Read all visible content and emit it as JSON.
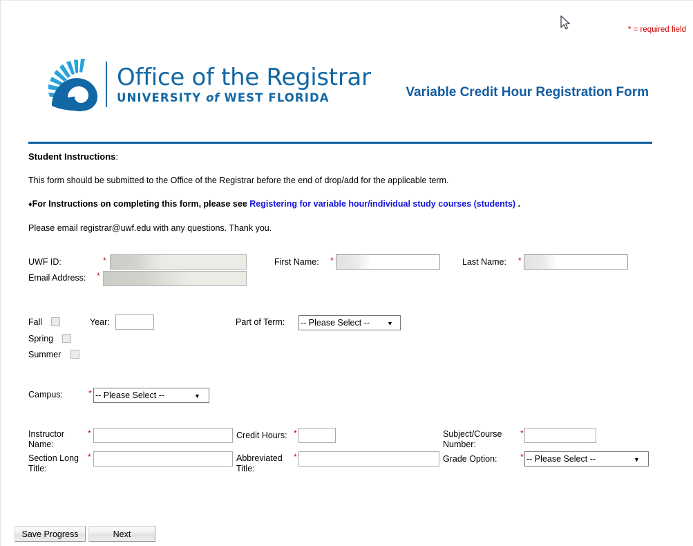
{
  "page": {
    "required_note": "* = required field",
    "form_title": "Variable Credit Hour Registration Form"
  },
  "logo": {
    "line1": "Office of the Registrar",
    "line2_pre": "UNIVERSITY ",
    "line2_italic": "of",
    "line2_post": " WEST FLORIDA"
  },
  "instructions": {
    "heading_bold": "Student Instructions",
    "heading_colon": ":",
    "line1": "This form should be submitted to the Office of the Registrar before the end of drop/add for the applicable term.",
    "bullet": "♦",
    "line2_pre": "For Instructions on completing this form, please see ",
    "line2_link": "Registering for variable hour/individual study courses (students)",
    "line2_post": " .",
    "line3": "Please email registrar@uwf.edu with any questions. Thank you."
  },
  "student": {
    "uwf_id_label": "UWF ID:",
    "uwf_id_value": "",
    "email_label": "Email Address:",
    "email_value": "",
    "first_name_label": "First Name:",
    "first_name_value": "",
    "last_name_label": "Last Name:",
    "last_name_value": "",
    "required_star": "*"
  },
  "term": {
    "fall_label": "Fall",
    "spring_label": "Spring",
    "summer_label": "Summer",
    "fall_checked": false,
    "spring_checked": false,
    "summer_checked": false,
    "year_label": "Year:",
    "year_value": "",
    "part_of_term_label": "Part of Term:",
    "part_of_term_value": "-- Please Select --",
    "part_of_term_options": [
      "-- Please Select --"
    ],
    "arrow_glyph": "▼"
  },
  "campus": {
    "label": "Campus:",
    "value": "-- Please Select --",
    "options": [
      "-- Please Select --"
    ],
    "required_star": "*"
  },
  "course": {
    "instructor_label_l1": "Instructor",
    "instructor_label_l2": "Name:",
    "instructor_value": "",
    "credit_hours_label": "Credit Hours:",
    "credit_hours_value": "",
    "subject_course_label_l1": "Subject/Course",
    "subject_course_label_l2": "Number:",
    "subject_course_value": "",
    "section_long_label_l1": "Section Long",
    "section_long_label_l2": "Title:",
    "section_long_value": "",
    "abbrev_label_l1": "Abbreviated",
    "abbrev_label_l2": "Title:",
    "abbrev_value": "",
    "grade_option_label": "Grade Option:",
    "grade_option_value": "-- Please Select --",
    "grade_option_options": [
      "-- Please Select --"
    ],
    "required_star": "*"
  },
  "footer": {
    "save_label": "Save Progress",
    "next_label": "Next"
  },
  "colors": {
    "brand_blue": "#0b5d9d",
    "title_blue": "#135ca0",
    "link_blue": "#1414e0",
    "required_red": "#cc0000",
    "logo_light_blue": "#29a3dc",
    "logo_dark_blue": "#1268a5"
  }
}
